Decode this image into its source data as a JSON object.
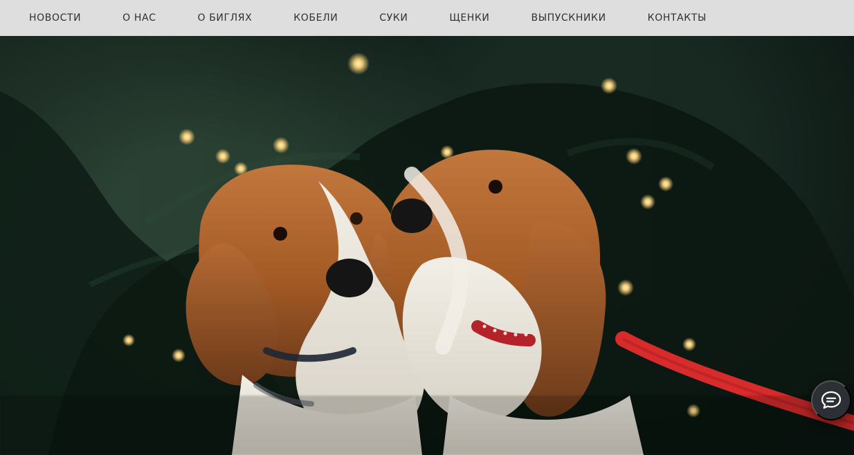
{
  "nav": {
    "items": [
      {
        "label": "НОВОСТИ"
      },
      {
        "label": "О НАС"
      },
      {
        "label": "О БИГЛЯХ"
      },
      {
        "label": "КОБЕЛИ"
      },
      {
        "label": "СУКИ"
      },
      {
        "label": "ЩЕНКИ"
      },
      {
        "label": "ВЫПУСКНИКИ"
      },
      {
        "label": "КОНТАКТЫ"
      }
    ]
  },
  "hero": {
    "alt_text": ""
  },
  "chat_widget": {
    "icon": "chat-bubble-icon"
  },
  "colors": {
    "nav_bg": "#dedede",
    "nav_text": "#2f2f2f",
    "chat_bg": "#2c2f33",
    "leash_red": "#d82b2b",
    "light_glow": "#ffd37a"
  }
}
